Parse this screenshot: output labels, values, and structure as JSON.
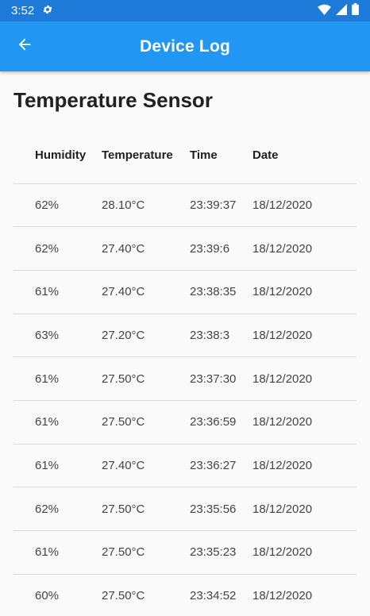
{
  "status_bar": {
    "time": "3:52",
    "icons": [
      "gear-icon",
      "wifi-icon",
      "signal-icon",
      "battery-icon"
    ]
  },
  "app_bar": {
    "title": "Device Log",
    "back_icon": "arrow-left-icon",
    "color": "#2196f3"
  },
  "page": {
    "title": "Temperature Sensor"
  },
  "table": {
    "headers": [
      "Humidity",
      "Temperature",
      "Time",
      "Date"
    ],
    "rows": [
      [
        "62%",
        "28.10°C",
        "23:39:37",
        "18/12/2020"
      ],
      [
        "62%",
        "27.40°C",
        "23:39:6",
        "18/12/2020"
      ],
      [
        "61%",
        "27.40°C",
        "23:38:35",
        "18/12/2020"
      ],
      [
        "63%",
        "27.20°C",
        "23:38:3",
        "18/12/2020"
      ],
      [
        "61%",
        "27.50°C",
        "23:37:30",
        "18/12/2020"
      ],
      [
        "61%",
        "27.50°C",
        "23:36:59",
        "18/12/2020"
      ],
      [
        "61%",
        "27.40°C",
        "23:36:27",
        "18/12/2020"
      ],
      [
        "62%",
        "27.50°C",
        "23:35:56",
        "18/12/2020"
      ],
      [
        "61%",
        "27.50°C",
        "23:35:23",
        "18/12/2020"
      ],
      [
        "60%",
        "27.50°C",
        "23:34:52",
        "18/12/2020"
      ]
    ]
  }
}
